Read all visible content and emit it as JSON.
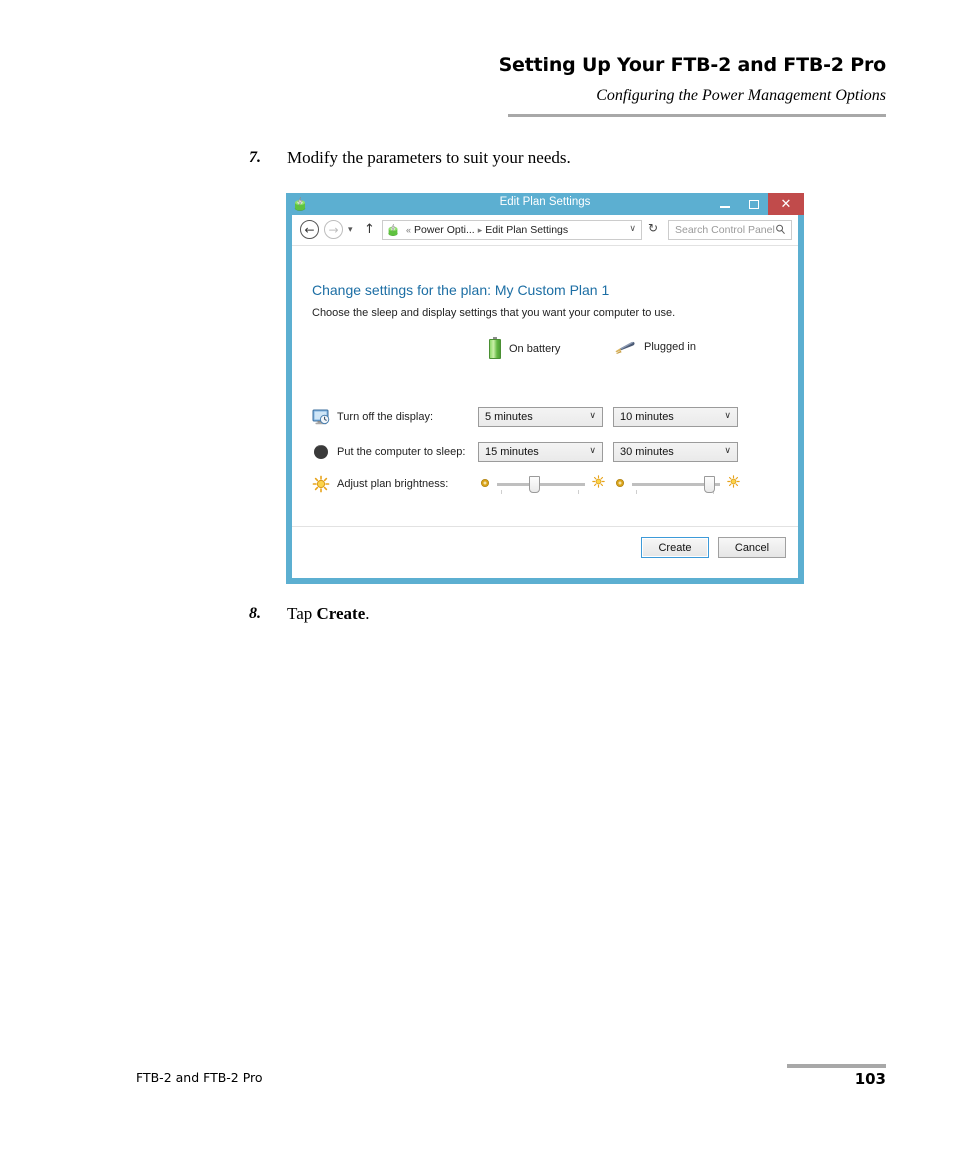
{
  "header": {
    "title": "Setting Up Your FTB-2 and FTB-2 Pro",
    "subtitle": "Configuring the Power Management Options"
  },
  "steps": [
    {
      "number": "7.",
      "text": "Modify the parameters to suit your needs."
    },
    {
      "number": "8.",
      "text_before": "Tap ",
      "text_bold": "Create",
      "text_after": "."
    }
  ],
  "dialog": {
    "title": "Edit Plan Settings",
    "app_icon": "power-options-icon",
    "window_buttons": {
      "minimize": "–",
      "maximize": "□",
      "close": "✕"
    },
    "navbar": {
      "back_icon": "back-arrow-icon",
      "forward_icon": "forward-arrow-icon",
      "recent_icon": "▾",
      "up_icon": "↑",
      "address_icon": "power-options-icon",
      "address_separator_1": "«",
      "breadcrumb_1": "Power Opti...",
      "address_separator_2": "▸",
      "breadcrumb_2": "Edit Plan Settings",
      "address_caret": "∨",
      "refresh_icon": "↻",
      "search_placeholder": "Search Control Panel",
      "search_icon": "⚲"
    },
    "content": {
      "heading": "Change settings for the plan: My Custom Plan 1",
      "subheading": "Choose the sleep and display settings that you want your computer to use.",
      "columns": [
        {
          "icon": "battery-icon",
          "label": "On battery"
        },
        {
          "icon": "plug-icon",
          "label": "Plugged in"
        }
      ],
      "rows": [
        {
          "icon": "display-clock-icon",
          "label": "Turn off the display:",
          "type": "combo",
          "on_battery": "5 minutes",
          "plugged_in": "10 minutes",
          "caret": "∨"
        },
        {
          "icon": "sleep-moon-icon",
          "label": "Put the computer to sleep:",
          "type": "combo",
          "on_battery": "15 minutes",
          "plugged_in": "30 minutes",
          "caret": "∨"
        },
        {
          "icon": "brightness-sun-icon",
          "label": "Adjust plan brightness:",
          "type": "slider",
          "on_battery_percent": 42,
          "plugged_in_percent": 88,
          "low_icon": "dim-sun-icon",
          "high_icon": "bright-sun-icon"
        }
      ]
    },
    "buttons": {
      "create": "Create",
      "cancel": "Cancel"
    }
  },
  "footer": {
    "left": "FTB-2 and FTB-2 Pro",
    "page": "103"
  },
  "colors": {
    "window_frame": "#5cafd1",
    "close_button": "#c14b4b",
    "heading_blue": "#1c6ea4",
    "rule_gray": "#a8a8a8"
  }
}
